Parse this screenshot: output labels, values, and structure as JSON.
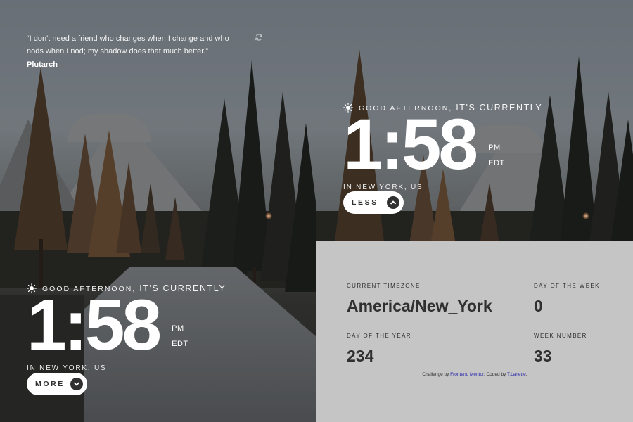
{
  "quote": {
    "text": "“I don't need a friend who changes when I change and who nods when I nod; my shadow does that much better.”",
    "author": "Plutarch",
    "refresh_icon": "refresh-icon"
  },
  "clock": {
    "greeting": "GOOD AFTERNOON,",
    "greeting_suffix": "IT'S CURRENTLY",
    "time": "1:58",
    "period": "PM",
    "zone_abbr": "EDT",
    "location": "IN NEW YORK, US",
    "icon": "sun-icon"
  },
  "toggle": {
    "more_label": "MORE",
    "less_label": "LESS"
  },
  "details": {
    "timezone_label": "CURRENT TIMEZONE",
    "timezone_value": "America/New_York",
    "day_of_year_label": "DAY OF THE YEAR",
    "day_of_year_value": "234",
    "day_of_week_label": "DAY OF THE WEEK",
    "day_of_week_value": "0",
    "week_number_label": "WEEK NUMBER",
    "week_number_value": "33"
  },
  "credit": {
    "prefix": "Challenge by",
    "link1": "Frontend Mentor",
    "middle": ". Coded by",
    "link2": "T.Lanette",
    "suffix": "."
  },
  "colors": {
    "text_light": "#ffffff",
    "text_dark": "#303030",
    "drawer_bg": "#e1e1e1",
    "link": "#2a2aa8"
  }
}
